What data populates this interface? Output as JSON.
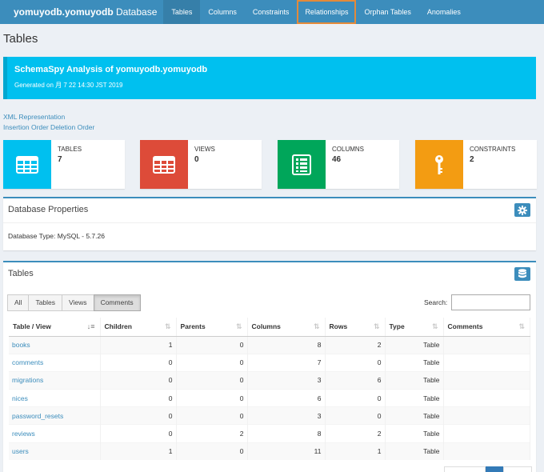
{
  "navbar": {
    "brand_bold": "yomuyodb.yomuyodb",
    "brand_rest": " Database",
    "items": [
      {
        "label": "Tables"
      },
      {
        "label": "Columns"
      },
      {
        "label": "Constraints"
      },
      {
        "label": "Relationships"
      },
      {
        "label": "Orphan Tables"
      },
      {
        "label": "Anomalies"
      }
    ],
    "active_item": "Tables",
    "highlighted_item": "Relationships"
  },
  "page": {
    "title": "Tables"
  },
  "callout": {
    "title": "SchemaSpy Analysis of yomuyodb.yomuyodb",
    "generated": "Generated on 月 7 22 14:30 JST 2019"
  },
  "links": [
    "XML Representation",
    "Insertion Order Deletion Order"
  ],
  "stats": [
    {
      "label": "TABLES",
      "value": "7",
      "color": "#00c0ef",
      "icon": "table-icon"
    },
    {
      "label": "VIEWS",
      "value": "0",
      "color": "#dd4b39",
      "icon": "table-icon"
    },
    {
      "label": "COLUMNS",
      "value": "46",
      "color": "#00a65a",
      "icon": "list-icon"
    },
    {
      "label": "CONSTRAINTS",
      "value": "2",
      "color": "#f39c12",
      "icon": "key-icon"
    }
  ],
  "db_props": {
    "title": "Database Properties",
    "db_type": "Database Type: MySQL - 5.7.26"
  },
  "tables_box": {
    "title": "Tables",
    "filters": [
      "All",
      "Tables",
      "Views",
      "Comments"
    ],
    "active_filter": "Comments",
    "search_label": "Search:",
    "search_value": ""
  },
  "table": {
    "headers": [
      "Table / View",
      "Children",
      "Parents",
      "Columns",
      "Rows",
      "Type",
      "Comments"
    ],
    "rows": [
      {
        "name": "books",
        "children": "1",
        "parents": "0",
        "columns": "8",
        "rows": "2",
        "type": "Table",
        "comments": ""
      },
      {
        "name": "comments",
        "children": "0",
        "parents": "0",
        "columns": "7",
        "rows": "0",
        "type": "Table",
        "comments": ""
      },
      {
        "name": "migrations",
        "children": "0",
        "parents": "0",
        "columns": "3",
        "rows": "6",
        "type": "Table",
        "comments": ""
      },
      {
        "name": "nices",
        "children": "0",
        "parents": "0",
        "columns": "6",
        "rows": "0",
        "type": "Table",
        "comments": ""
      },
      {
        "name": "password_resets",
        "children": "0",
        "parents": "0",
        "columns": "3",
        "rows": "0",
        "type": "Table",
        "comments": ""
      },
      {
        "name": "reviews",
        "children": "0",
        "parents": "2",
        "columns": "8",
        "rows": "2",
        "type": "Table",
        "comments": ""
      },
      {
        "name": "users",
        "children": "1",
        "parents": "0",
        "columns": "11",
        "rows": "1",
        "type": "Table",
        "comments": ""
      }
    ]
  }
}
